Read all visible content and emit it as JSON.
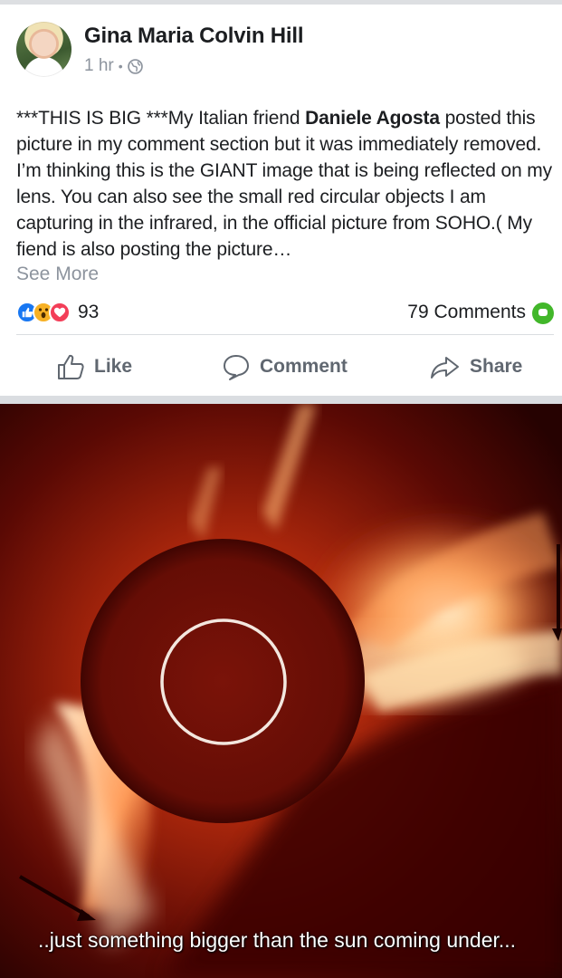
{
  "post": {
    "author": "Gina Maria Colvin Hill",
    "time": "1 hr",
    "privacy_icon": "globe-icon",
    "text_intro": "***THIS IS BIG ***My Italian friend ",
    "tagged_name": "Daniele Agosta",
    "text_rest": " posted this picture in my comment section but it was immediately removed. I’m thinking this is the GIANT image that is being reflected on my lens. You can also see the small red circular objects I am capturing in the infrared, in the official picture from SOHO.( My fiend is also posting the picture…",
    "see_more": "See More"
  },
  "reactions": {
    "icons": [
      "like-icon",
      "wow-icon",
      "love-icon"
    ],
    "count": "93"
  },
  "comments": {
    "label": "79 Comments"
  },
  "actions": {
    "like": "Like",
    "comment": "Comment",
    "share": "Share"
  },
  "photo": {
    "caption": "..just something bigger than the sun coming under..."
  },
  "colors": {
    "accent_blue": "#1877f2",
    "wow_yellow": "#f7b125",
    "love_red": "#f33e58",
    "comment_green": "#42b72a",
    "muted_text": "#8d949e",
    "action_text": "#606770"
  }
}
